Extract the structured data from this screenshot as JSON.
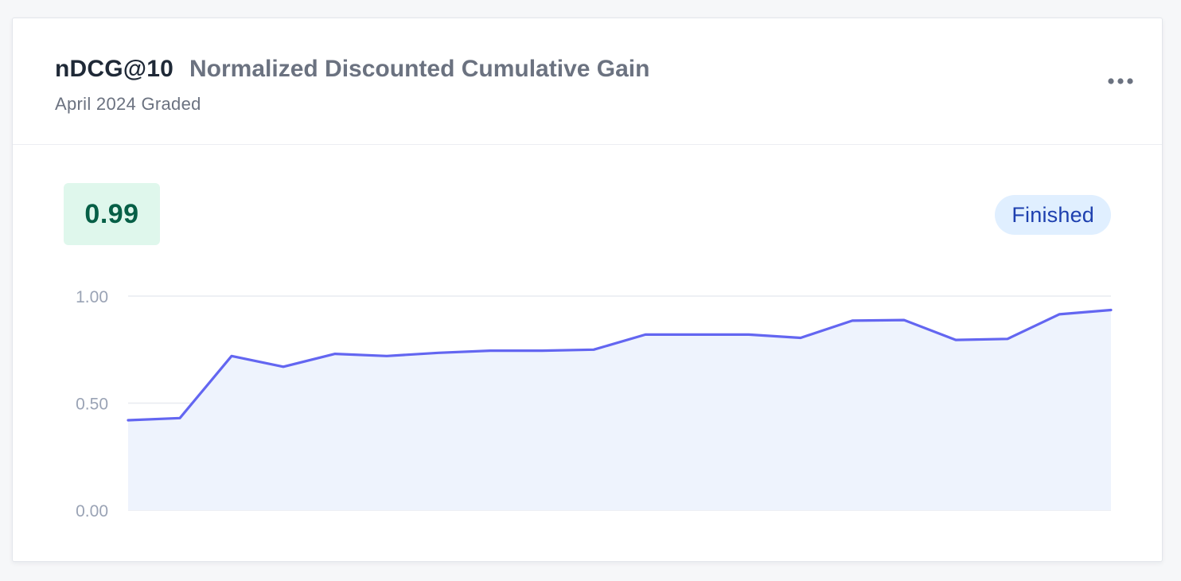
{
  "header": {
    "metric_name": "nDCG@10",
    "metric_full_name": "Normalized Discounted Cumulative Gain",
    "subtitle": "April 2024 Graded",
    "more_icon": "more-horizontal-icon"
  },
  "score": "0.99",
  "status": "Finished",
  "colors": {
    "line": "#6366f1",
    "area": "#eef3fd",
    "score_bg": "#dff7ec",
    "score_text": "#065f46",
    "status_bg": "#e0efff",
    "status_text": "#1e40af",
    "grid": "#e8ebf0"
  },
  "chart_data": {
    "type": "area",
    "y_ticks": [
      "1.00",
      "0.50",
      "0.00"
    ],
    "ylim": [
      0,
      1
    ],
    "grid": true,
    "series": [
      {
        "values": [
          0.42,
          0.43,
          0.72,
          0.67,
          0.73,
          0.72,
          0.735,
          0.745,
          0.745,
          0.75,
          0.82,
          0.82,
          0.82,
          0.805,
          0.885,
          0.888,
          0.795,
          0.8,
          0.915,
          0.935
        ]
      }
    ]
  }
}
